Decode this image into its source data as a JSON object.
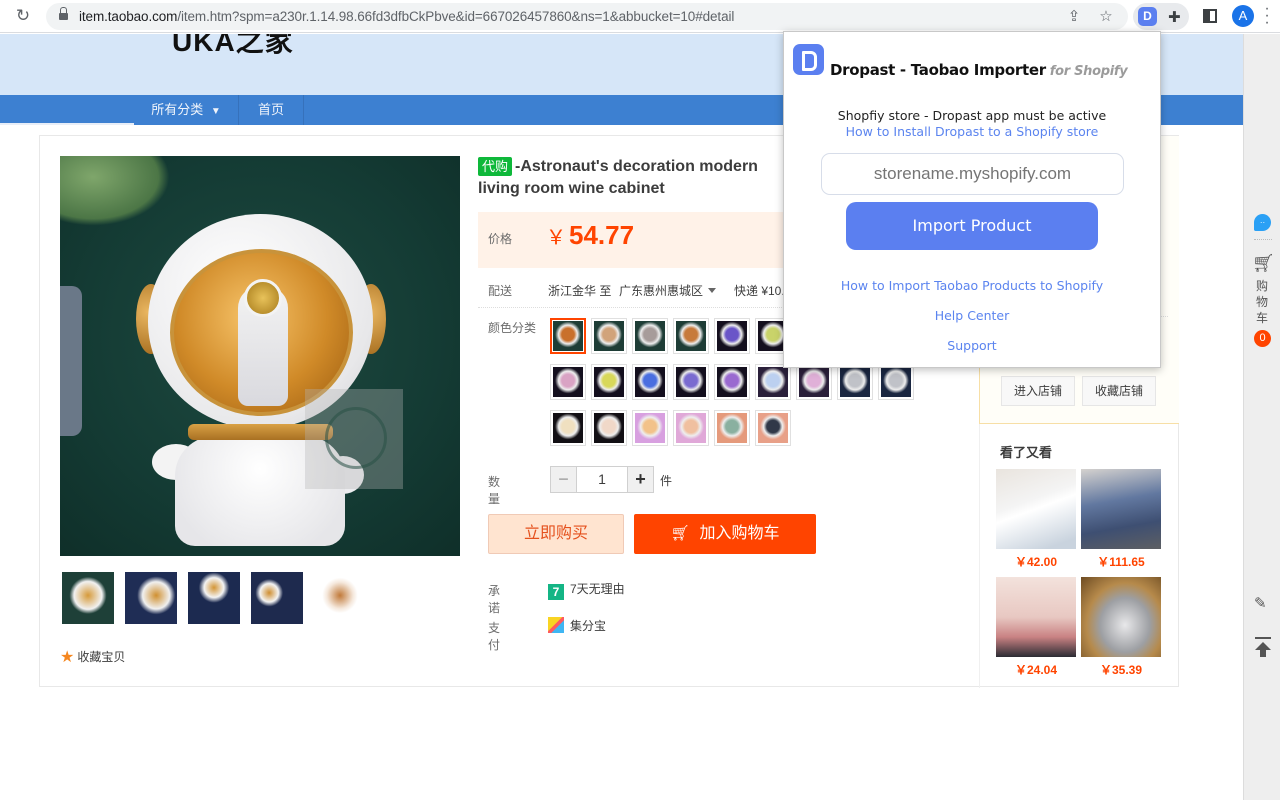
{
  "browser": {
    "url_host": "item.taobao.com",
    "url_path": "/item.htm?spm=a230r.1.14.98.66fd3dfbCkPbve&id=667026457860&ns=1&abbucket=10#detail",
    "avatar_letter": "A",
    "extension_letter": "D",
    "icons": [
      "reload-icon",
      "lock-icon",
      "share-icon",
      "star-icon",
      "dropast-extension-icon",
      "puzzle-icon",
      "side-panel-icon",
      "profile-avatar",
      "more-menu-icon"
    ]
  },
  "shop": {
    "logo_text": "UKA之家",
    "nav": [
      {
        "label": "所有分类"
      },
      {
        "label": "首页"
      }
    ]
  },
  "product": {
    "badge": "代购",
    "title": "-Astronaut's decoration modern living room wine cabinet",
    "title_visible_line2": "e cabinet",
    "price_label": "价格",
    "currency": "￥",
    "price": "54.77",
    "ship_label": "配送",
    "ship_from": "浙江金华 至",
    "ship_to": "广东惠州惠城区",
    "ship_fee": "快递 ¥10.",
    "color_label": "颜色分类",
    "swatch_count": 27,
    "selected_swatch": 0,
    "qty_label": "数量",
    "qty_value": "1",
    "qty_unit": "件",
    "minus": "−",
    "plus": "+",
    "buy_now": "立即购买",
    "add_cart": "加入购物车",
    "promise_label": "承诺",
    "promise_value": "7天无理由",
    "promise_icon": "7",
    "pay_label": "支付",
    "pay_value": "集分宝",
    "favorite": "收藏宝贝",
    "thumb_count": 5
  },
  "store": {
    "enter": "进入店铺",
    "favorite": "收藏店铺",
    "also_viewed_title": "看了又看",
    "also_viewed": [
      {
        "price": "￥42.00"
      },
      {
        "price": "￥111.65"
      },
      {
        "price": "￥24.04"
      },
      {
        "price": "￥35.39"
      }
    ]
  },
  "right_toolbar": {
    "cart_label": "购物车",
    "cart_count": "0"
  },
  "popup": {
    "title": "Dropast - Taobao Importer",
    "subtitle": "for Shopify",
    "requirement": "Shopfiy store - Dropast app must be active",
    "install_link": "How to Install Dropast to a Shopify store",
    "store_placeholder": "storename.myshopify.com",
    "import_button": "Import Product",
    "links": [
      {
        "label": "How to Import Taobao Products to Shopify"
      },
      {
        "label": "Help Center"
      },
      {
        "label": "Support"
      }
    ],
    "accent": "#5b7ff0",
    "link_color": "#5b84ef"
  }
}
